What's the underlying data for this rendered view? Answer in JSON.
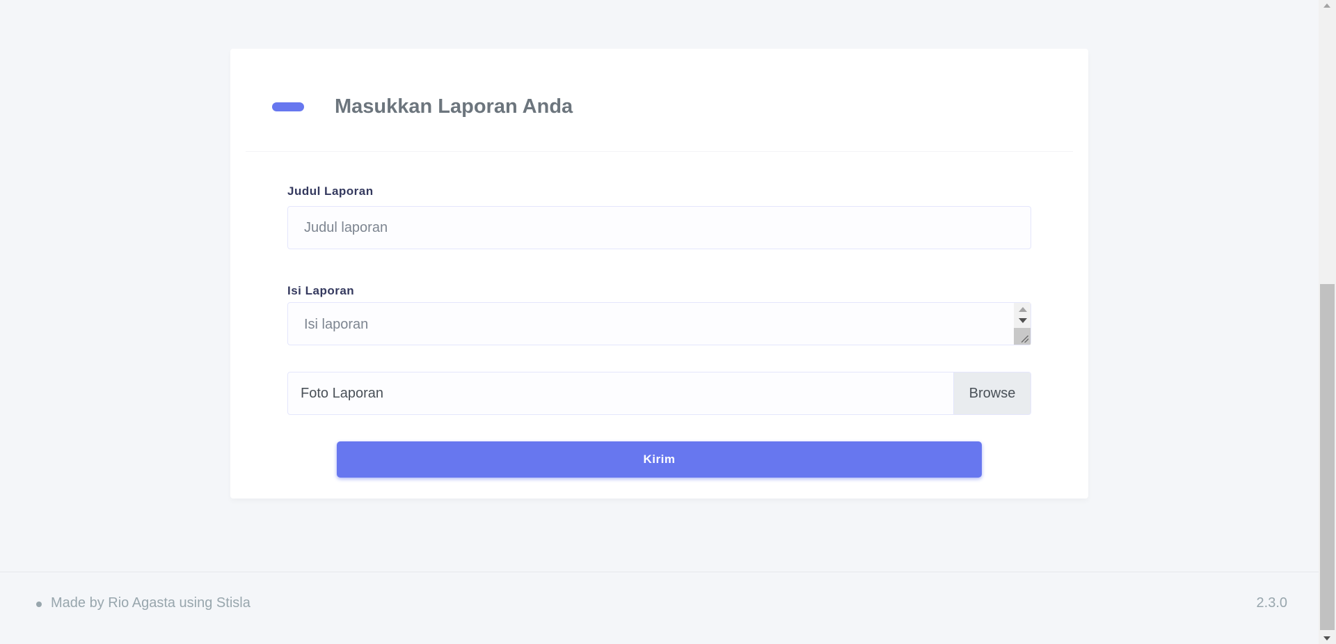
{
  "card": {
    "title": "Masukkan Laporan Anda"
  },
  "form": {
    "judul": {
      "label": "Judul Laporan",
      "placeholder": "Judul laporan",
      "value": ""
    },
    "isi": {
      "label": "Isi Laporan",
      "placeholder": "Isi laporan",
      "value": ""
    },
    "foto": {
      "label": "Foto Laporan",
      "browse_label": "Browse"
    },
    "submit_label": "Kirim"
  },
  "footer": {
    "left_text": "Made by Rio Agasta using Stisla",
    "version": "2.3.0"
  },
  "colors": {
    "primary": "#6777ef",
    "background": "#f4f6f9",
    "muted_text": "#98a6ad"
  },
  "icons": {
    "header_bar": "primary-pill-bar",
    "footer_bullet": "bullet-dot"
  }
}
